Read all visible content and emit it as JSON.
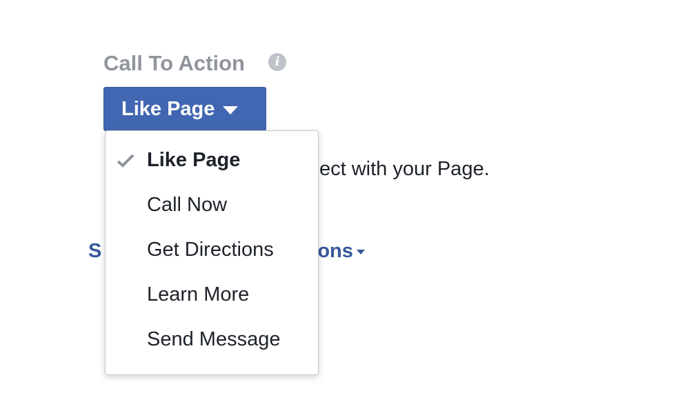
{
  "cta": {
    "label": "Call To Action",
    "info_icon": "info-icon",
    "button_label": "Like Page"
  },
  "description": {
    "visible_text": "ect with your Page."
  },
  "settings_link": {
    "visible_text": "S                                   ons"
  },
  "menu": {
    "selected": "Like Page",
    "items": [
      {
        "label": "Like Page"
      },
      {
        "label": "Call Now"
      },
      {
        "label": "Get Directions"
      },
      {
        "label": "Learn More"
      },
      {
        "label": "Send Message"
      }
    ]
  },
  "colors": {
    "button_bg": "#4267b2",
    "link": "#365899",
    "label_gray": "#90949c"
  }
}
